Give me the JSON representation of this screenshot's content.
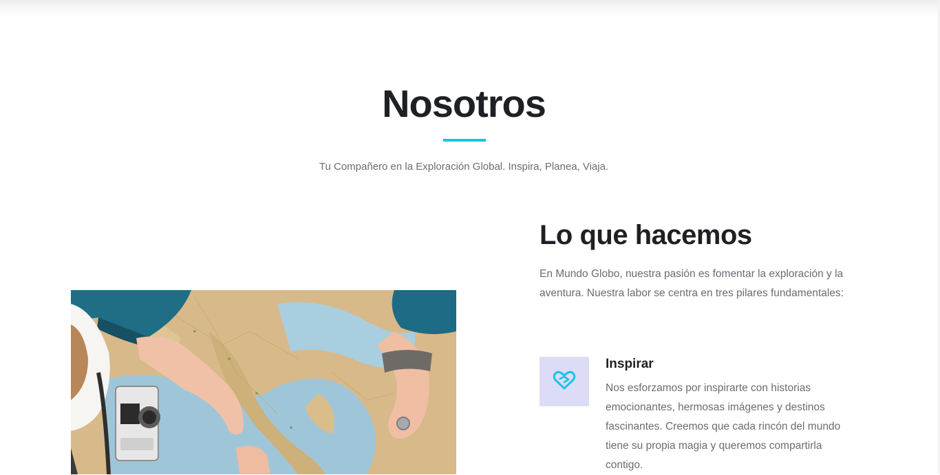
{
  "about": {
    "title": "Nosotros",
    "subtitle": "Tu Compañero en la Exploración Global. Inspira, Planea, Viaja."
  },
  "what_we_do": {
    "heading": "Lo que hacemos",
    "intro": "En Mundo Globo, nuestra pasión es fomentar la exploración y la aventura. Nuestra labor se centra en tres pilares fundamentales:",
    "features": [
      {
        "icon": "heart-handshake-icon",
        "title": "Inspirar",
        "text": "Nos esforzamos por inspirarte con historias emocionantes, hermosas imágenes y destinos fascinantes. Creemos que cada rincón del mundo tiene su propia magia y queremos compartirla contigo."
      }
    ]
  },
  "photo": {
    "subject": "travel-map-photo"
  },
  "colors": {
    "accent": "#16c3ec",
    "heading": "#1f2024",
    "body_text": "#6b6b73",
    "icon_box_bg": "#dcdcf7"
  }
}
